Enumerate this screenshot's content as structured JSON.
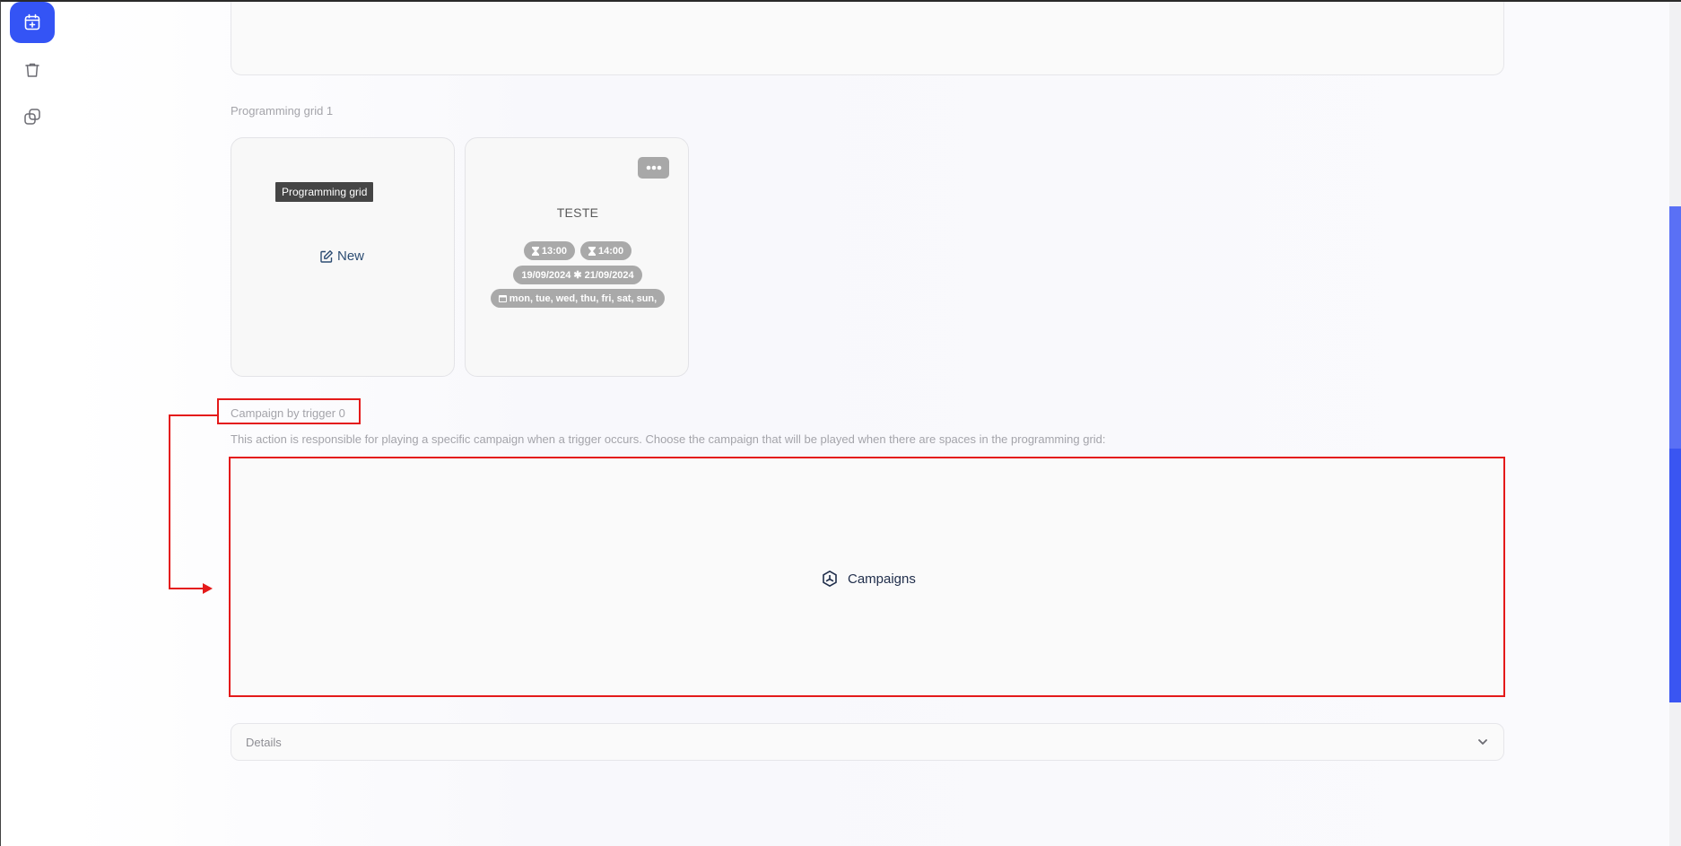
{
  "sidebar": {
    "items": [
      {
        "name": "calendar-add-icon",
        "active": true
      },
      {
        "name": "trash-icon",
        "active": false
      },
      {
        "name": "copy-icon",
        "active": false
      }
    ],
    "accent": "#3454f5"
  },
  "programming_grid": {
    "section_label": "Programming grid 1",
    "new_card": {
      "tooltip": "Programming grid",
      "new_label": "New"
    },
    "grid_item": {
      "title": "TESTE",
      "start_time": "13:00",
      "end_time": "14:00",
      "start_date": "19/09/2024",
      "end_date": "21/09/2024",
      "days": "mon, tue, wed, thu, fri, sat, sun,"
    }
  },
  "campaign_trigger": {
    "label": "Campaign by trigger 0",
    "description": "This action is responsible for playing a specific campaign when a trigger occurs. Choose the campaign that will be played when there are spaces in the programming grid:",
    "campaigns_label": "Campaigns",
    "highlight_color": "#e41a1a"
  },
  "details": {
    "label": "Details"
  }
}
